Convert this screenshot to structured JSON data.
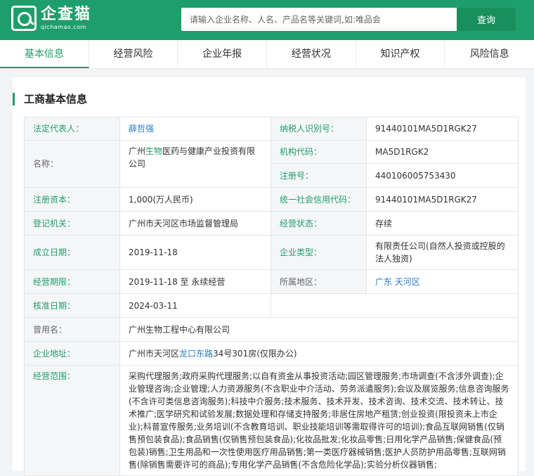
{
  "logo": {
    "title": "企查猫",
    "subtitle": "qichamao.com"
  },
  "search": {
    "placeholder": "请输入企业名称、人名、产品名等关键词,如:唯品会",
    "button": "查询"
  },
  "tabs": [
    "基本信息",
    "经营风险",
    "企业年报",
    "经营状况",
    "知识产权",
    "风险信息"
  ],
  "section": {
    "title": "工商基本信息"
  },
  "fields": {
    "legal_rep_label": "法定代表人：",
    "legal_rep": "薛哲强",
    "tax_id_label": "纳税人识别号：",
    "tax_id": "91440101MA5D1RGK27",
    "name_label": "名称：",
    "name_pre": "广州",
    "name_hl": "生物",
    "name_post": "医药与健康产业投资有限公司",
    "org_code_label": "机构代码：",
    "org_code": "MA5D1RGK2",
    "reg_no_label": "注册号：",
    "reg_no": "440106005753430",
    "capital_label": "注册资本：",
    "capital": "1,000(万人民币)",
    "credit_code_label": "统一社会信用代码：",
    "credit_code": "91440101MA5D1RGK27",
    "authority_label": "登记机关：",
    "authority": "广州市天河区市场监督管理局",
    "status_label": "经营状态：",
    "status": "存续",
    "founded_label": "成立日期：",
    "founded": "2019-11-18",
    "type_label": "企业类型：",
    "type": "有限责任公司(自然人投资或控股的法人独资)",
    "term_label": "经营期限：",
    "term": "2019-11-18 至 永续经营",
    "region_label": "所属地区：",
    "region": "广东 天河区",
    "approved_label": "核准日期：",
    "approved": "2024-03-11",
    "former_label": "曾用名：",
    "former": "广州生物工程中心有限公司",
    "address_label": "企业地址：",
    "address_pre": "广州市天河区",
    "address_link": "龙口东路",
    "address_post": "34号301房(仅限办公)",
    "scope_label": "经营范围：",
    "scope": "采购代理服务;政府采购代理服务;以自有资金从事投资活动;园区管理服务;市场调查(不含涉外调查);企业管理咨询;企业管理;人力资源服务(不含职业中介活动、劳务派遣服务);会议及展览服务;信息咨询服务(不含许可类信息咨询服务);科技中介服务;技术服务、技术开发、技术咨询、技术交流、技术转让、技术推广;医学研究和试验发展;数据处理和存储支持服务;非居住房地产租赁;创业投资(限投资未上市企业);科普宣传服务;业务培训(不含教育培训、职业技能培训等需取得许可的培训);食品互联网销售(仅销售预包装食品);食品销售(仅销售预包装食品);化妆品批发;化妆品零售;日用化学产品销售;保健食品(预包装)销售;卫生用品和一次性使用医疗用品销售;第一类医疗器械销售;医护人员防护用品零售;互联网销售(除销售需要许可的商品);专用化学产品销售(不含危险化学品);实验分析仪器销售;"
  },
  "colors": {
    "brand": "#1e9e6a",
    "link": "#2a7cc7"
  }
}
